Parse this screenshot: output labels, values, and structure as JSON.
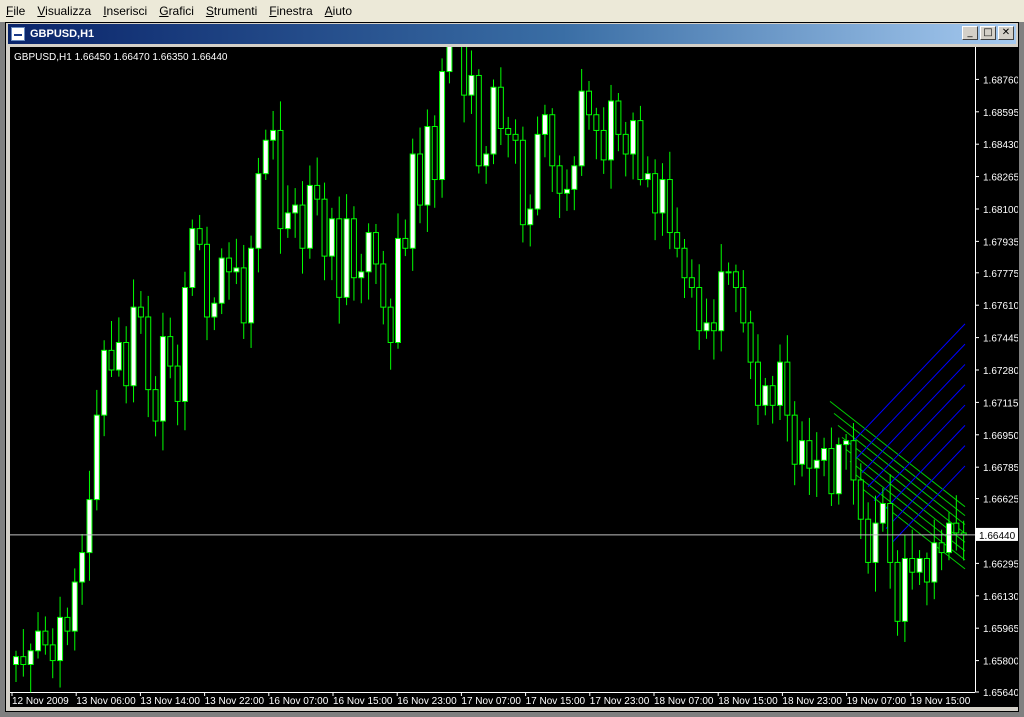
{
  "menu": [
    "File",
    "Visualizza",
    "Inserisci",
    "Grafici",
    "Strumenti",
    "Finestra",
    "Aiuto"
  ],
  "window": {
    "title": "GBPUSD,H1",
    "buttons": {
      "minimize": "_",
      "maximize": "□",
      "close": "✕"
    }
  },
  "chart_info": "GBPUSD,H1  1.66450 1.66470 1.66350 1.66440",
  "colors": {
    "background": "#000000",
    "bull": "#ffffff",
    "bear": "#000000",
    "wick": "#00ff00",
    "channel_green": "#00cc00",
    "channel_blue": "#0000ff",
    "axis_text": "#ffffff",
    "current_price_line": "#c0c0c0"
  },
  "chart_data": {
    "type": "candlestick",
    "symbol": "GBPUSD",
    "timeframe": "H1",
    "ylim": [
      1.6564,
      1.68925
    ],
    "y_ticks": [
      1.6876,
      1.68595,
      1.6843,
      1.68265,
      1.681,
      1.67935,
      1.67775,
      1.6761,
      1.67445,
      1.6728,
      1.67115,
      1.6695,
      1.66785,
      1.66625,
      1.6646,
      1.66295,
      1.6613,
      1.65965,
      1.658,
      1.6564
    ],
    "y_tick_labels": [
      "1.68760",
      "1.68595",
      "1.68430",
      "1.68265",
      "1.68100",
      "1.67935",
      "1.67775",
      "1.67610",
      "1.67445",
      "1.67280",
      "1.67115",
      "1.66950",
      "1.66785",
      "1.66625",
      "1.66460",
      "1.66295",
      "1.66130",
      "1.65965",
      "1.65800",
      "1.65640"
    ],
    "x_ticks": [
      "12 Nov 2009",
      "13 Nov 06:00",
      "13 Nov 14:00",
      "13 Nov 22:00",
      "16 Nov 07:00",
      "16 Nov 15:00",
      "16 Nov 23:00",
      "17 Nov 07:00",
      "17 Nov 15:00",
      "17 Nov 23:00",
      "18 Nov 07:00",
      "18 Nov 15:00",
      "18 Nov 23:00",
      "19 Nov 07:00",
      "19 Nov 15:00"
    ],
    "current_price": 1.6644,
    "current_price_label": "1.66440",
    "close": [
      1.6582,
      1.6578,
      1.6585,
      1.6595,
      1.6588,
      1.658,
      1.6602,
      1.6595,
      1.662,
      1.6635,
      1.6662,
      1.6705,
      1.6738,
      1.6728,
      1.6742,
      1.672,
      1.676,
      1.6755,
      1.6718,
      1.6702,
      1.6745,
      1.673,
      1.6712,
      1.677,
      1.68,
      1.6792,
      1.6755,
      1.6762,
      1.6785,
      1.6778,
      1.678,
      1.6752,
      1.679,
      1.6828,
      1.6845,
      1.685,
      1.68,
      1.6808,
      1.6812,
      1.679,
      1.6822,
      1.6815,
      1.6786,
      1.6805,
      1.6765,
      1.6805,
      1.6775,
      1.6778,
      1.6798,
      1.6782,
      1.676,
      1.6742,
      1.6795,
      1.679,
      1.6838,
      1.6812,
      1.6852,
      1.6825,
      1.688,
      1.6902,
      1.69,
      1.6868,
      1.6878,
      1.6832,
      1.6838,
      1.6872,
      1.6851,
      1.6848,
      1.6845,
      1.6802,
      1.681,
      1.6848,
      1.6858,
      1.6832,
      1.6818,
      1.682,
      1.6832,
      1.687,
      1.6858,
      1.685,
      1.6835,
      1.6865,
      1.6848,
      1.6838,
      1.6855,
      1.6825,
      1.6828,
      1.6808,
      1.6825,
      1.6798,
      1.679,
      1.6775,
      1.677,
      1.6748,
      1.6752,
      1.6748,
      1.6778,
      1.6778,
      1.677,
      1.6752,
      1.6732,
      1.671,
      1.672,
      1.671,
      1.6732,
      1.6705,
      1.668,
      1.6692,
      1.6678,
      1.6682,
      1.6688,
      1.6665,
      1.669,
      1.6692,
      1.6672,
      1.6652,
      1.663,
      1.665,
      1.666,
      1.663,
      1.66,
      1.6632,
      1.6625,
      1.6632,
      1.662,
      1.664,
      1.6635,
      1.665,
      1.6645,
      1.6644
    ],
    "opens_highs_lows_note": "",
    "channels": {
      "green_lines": 8,
      "blue_lines": 8
    }
  }
}
